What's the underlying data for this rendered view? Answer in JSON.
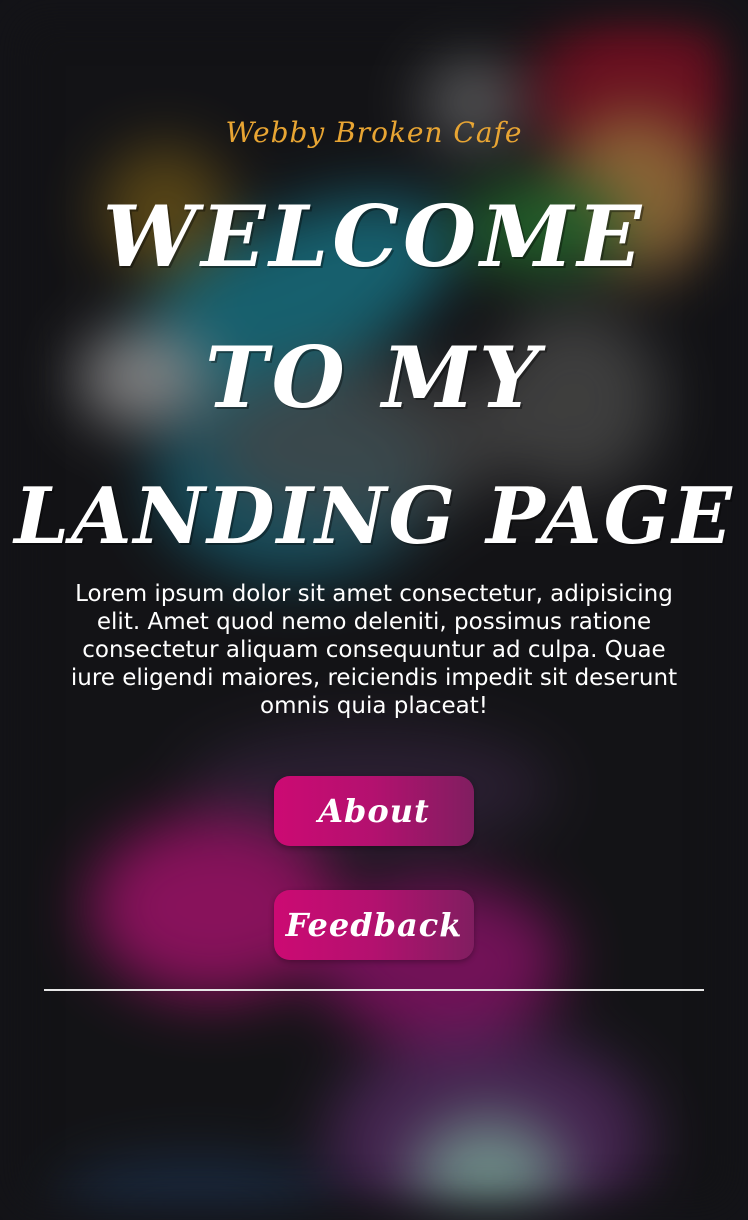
{
  "brand": {
    "name": "Webby Broken Cafe",
    "color": "#e8a533"
  },
  "hero": {
    "line1": "WELCOME",
    "line2": "TO MY",
    "line3": "LANDING PAGE",
    "description": "Lorem ipsum dolor sit amet consectetur, adipisicing elit. Amet quod nemo deleniti, possimus ratione consectetur aliquam consequuntur ad culpa. Quae iure eligendi maiores, reiciendis impedit sit deserunt omnis quia placeat!"
  },
  "buttons": {
    "about_label": "About",
    "feedback_label": "Feedback",
    "accent": "#cc0a73"
  }
}
